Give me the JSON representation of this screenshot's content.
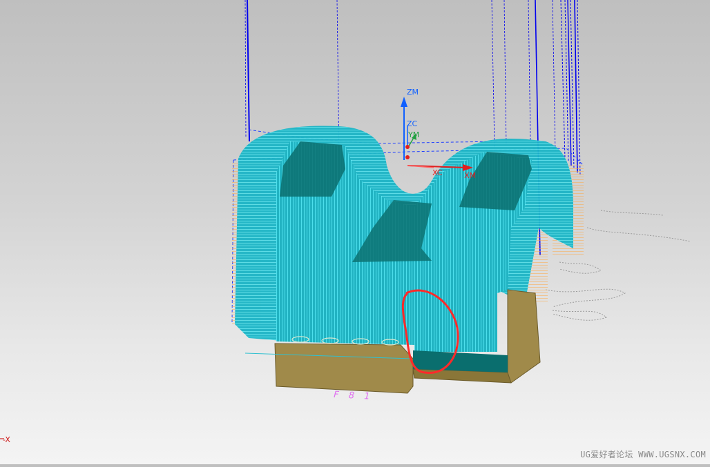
{
  "viewport": {
    "background_top": "#bfbfbf",
    "background_bottom": "#f4f4f4",
    "toolpath_color": "#17d6e6",
    "engage_color": "#ffa640",
    "rapid_color": "#0000ee",
    "part_base_color": "#a08a4a",
    "part_face_color": "#0a6e6e",
    "highlight_color": "#ff2a2a"
  },
  "axes": {
    "zm": "ZM",
    "zc": "ZC",
    "ym": "YM",
    "xc": "XC",
    "xm": "XM",
    "z_color": "#1060ff",
    "y_color": "#20a040",
    "x_color": "#e02020"
  },
  "part_annotation": "F 8 1",
  "view_triad_label": "-X",
  "watermark": "UG爱好者论坛 WWW.UGSNX.COM"
}
